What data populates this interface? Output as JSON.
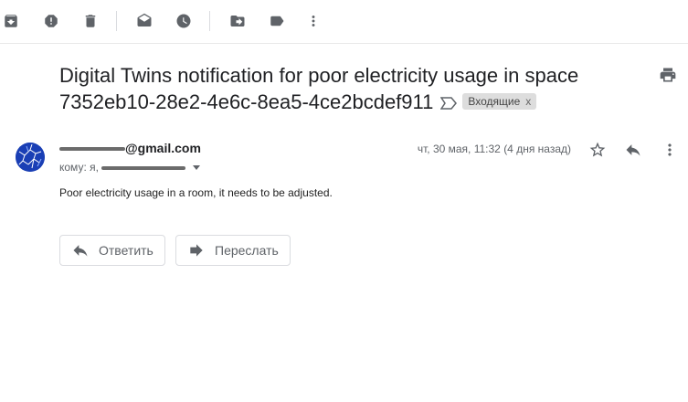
{
  "toolbar": {
    "items": [
      {
        "name": "archive",
        "icon": "archive-icon"
      },
      {
        "name": "report-spam",
        "icon": "report-spam-icon"
      },
      {
        "name": "delete",
        "icon": "trash-icon"
      },
      {
        "name": "mark-unread",
        "icon": "mark-unread-icon"
      },
      {
        "name": "snooze",
        "icon": "clock-icon"
      },
      {
        "name": "move-to",
        "icon": "move-to-icon"
      },
      {
        "name": "labels",
        "icon": "label-icon"
      },
      {
        "name": "more",
        "icon": "more-vert-icon"
      }
    ]
  },
  "email": {
    "subject": "Digital Twins notification for poor electricity usage in space 7352eb10-28e2-4e6c-8ea5-4ce2bcdef911",
    "label": "Входящие",
    "label_close": "x",
    "sender_domain": "@gmail.com",
    "recipient_prefix": "кому: я,",
    "date": "чт, 30 мая, 11:32 (4 дня назад)",
    "body": "Poor electricity usage in a room, it needs to be adjusted."
  },
  "actions": {
    "reply_label": "Ответить",
    "forward_label": "Переслать"
  },
  "colors": {
    "icon": "#5f6368",
    "text": "#202124",
    "avatar": "#1a3fb5",
    "chip_bg": "#dddddd"
  }
}
